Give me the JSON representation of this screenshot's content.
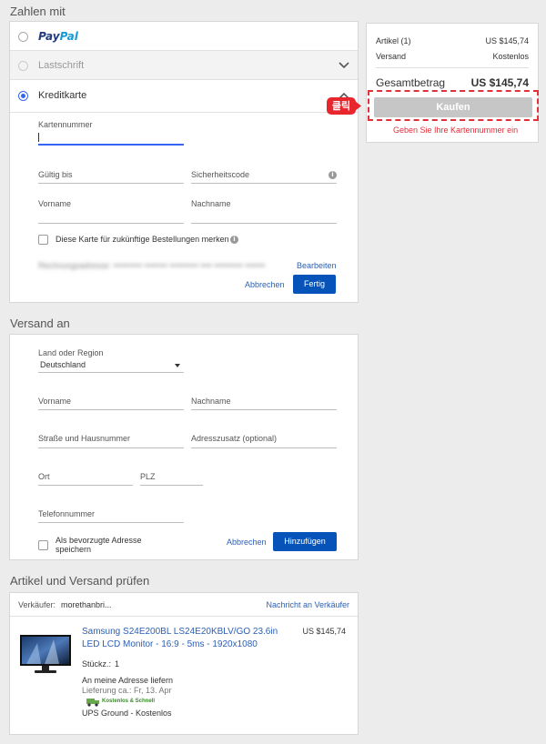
{
  "payment": {
    "title": "Zahlen mit",
    "options": [
      {
        "label": "PayPal",
        "selected": false
      },
      {
        "label": "Lastschrift",
        "selected": false
      },
      {
        "label": "Kreditkarte",
        "selected": true
      }
    ],
    "card_number_label": "Kartennummer",
    "card_number_value": "",
    "expiry_label": "Gültig bis",
    "security_code_label": "Sicherheitscode",
    "first_name_label": "Vorname",
    "last_name_label": "Nachname",
    "save_card_label": "Diese Karte für zukünftige Bestellungen merken",
    "billing_address_blurred": "Rechnungsadresse: •••••••••• •••••••• •••••••••• •••• •••••••••• •••••••",
    "edit_link": "Bearbeiten",
    "cancel_link": "Abbrechen",
    "done_button": "Fertig",
    "info_icon": "info-icon"
  },
  "summary": {
    "items_label": "Artikel (1)",
    "items_value": "US $145,74",
    "shipping_label": "Versand",
    "shipping_value": "Kostenlos",
    "total_label": "Gesamtbetrag",
    "total_value": "US $145,74",
    "buy_button": "Kaufen",
    "click_badge": "클릭",
    "error_message": "Geben Sie Ihre Kartennummer ein"
  },
  "shipping": {
    "title": "Versand an",
    "country_label": "Land oder Region",
    "country_value": "Deutschland",
    "first_name_label": "Vorname",
    "last_name_label": "Nachname",
    "street_label": "Straße und Hausnummer",
    "address2_label": "Adresszusatz (optional)",
    "city_label": "Ort",
    "zip_label": "PLZ",
    "phone_label": "Telefonnummer",
    "preferred_label_line1": "Als bevorzugte Adresse",
    "preferred_label_line2": "speichern",
    "cancel_link": "Abbrechen",
    "add_button": "Hinzufügen"
  },
  "review": {
    "title": "Artikel und Versand prüfen",
    "seller_label": "Verkäufer:",
    "seller_name": "morethanbri...",
    "contact_seller": "Nachricht an Verkäufer",
    "item_title_line1": "Samsung S24E200BL LS24E20KBLV/GO 23.6in",
    "item_title_line2": "LED LCD Monitor - 16:9 - 5ms - 1920x1080",
    "item_price": "US $145,74",
    "qty_label": "Stückz.:",
    "qty_value": "1",
    "delivery_to": "An meine Adresse liefern",
    "delivery_estimate": "Lieferung ca.: Fr, 13. Apr",
    "free_fast_badge": "Kostenlos & Schnell",
    "shipping_method": "UPS Ground - Kostenlos"
  },
  "colors": {
    "accent_blue": "#0654ba",
    "link_blue": "#2b5fb4",
    "error_red": "#e0303a",
    "badge_red": "#e8262e",
    "buy_disabled": "#c6c6c6"
  }
}
